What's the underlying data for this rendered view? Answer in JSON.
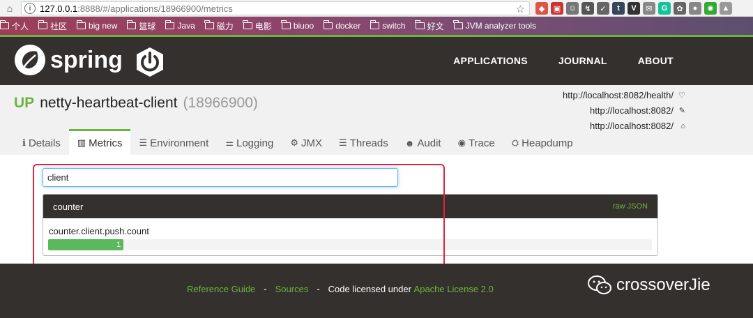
{
  "browser": {
    "url_host": "127.0.0.1",
    "url_rest": ":8888/#/applications/18966900/metrics",
    "bookmarks": [
      "个人",
      "社区",
      "big new",
      "篮球",
      "Java",
      "磁力",
      "电影",
      "biuoo",
      "docker",
      "switch",
      "好文",
      "JVM analyzer tools"
    ],
    "extensions": [
      {
        "name": "ext-multicolor-icon",
        "glyph": "◆",
        "color": "#d54"
      },
      {
        "name": "ext-box-icon",
        "glyph": "▣",
        "color": "#c33"
      },
      {
        "name": "ext-face-icon",
        "glyph": "☺",
        "color": "#777"
      },
      {
        "name": "ext-chart-icon",
        "glyph": "↯",
        "color": "#555"
      },
      {
        "name": "ext-checkbox-icon",
        "glyph": "✓",
        "color": "#666"
      },
      {
        "name": "ext-tumblr-icon",
        "glyph": "t",
        "color": "#35465c"
      },
      {
        "name": "ext-v-icon",
        "glyph": "V",
        "color": "#333"
      },
      {
        "name": "ext-mail-icon",
        "glyph": "✉",
        "color": "#888"
      },
      {
        "name": "ext-grammarly-icon",
        "glyph": "G",
        "color": "#15c39a"
      },
      {
        "name": "ext-puzzle-icon",
        "glyph": "✿",
        "color": "#666"
      },
      {
        "name": "ext-drop-icon",
        "glyph": "●",
        "color": "#888"
      },
      {
        "name": "ext-gear-icon",
        "glyph": "✺",
        "color": "#3a3"
      },
      {
        "name": "ext-arrow-icon",
        "glyph": "▲",
        "color": "#999"
      }
    ]
  },
  "header": {
    "logo_text": "spring",
    "nav": [
      "APPLICATIONS",
      "JOURNAL",
      "ABOUT"
    ]
  },
  "app": {
    "status": "UP",
    "name": "netty-heartbeat-client",
    "id": "(18966900)",
    "health_url": "http://localhost:8082/health/",
    "management_url": "http://localhost:8082/",
    "service_url": "http://localhost:8082/"
  },
  "tabs": [
    {
      "label": "Details",
      "icon": "info-icon",
      "glyph": "ℹ"
    },
    {
      "label": "Metrics",
      "icon": "bar-chart-icon",
      "glyph": "▥"
    },
    {
      "label": "Environment",
      "icon": "list-icon",
      "glyph": "☰"
    },
    {
      "label": "Logging",
      "icon": "sliders-icon",
      "glyph": "⚌"
    },
    {
      "label": "JMX",
      "icon": "cogs-icon",
      "glyph": "⚙"
    },
    {
      "label": "Threads",
      "icon": "threads-icon",
      "glyph": "☰"
    },
    {
      "label": "Audit",
      "icon": "user-icon",
      "glyph": "☻"
    },
    {
      "label": "Trace",
      "icon": "eye-icon",
      "glyph": "◉"
    },
    {
      "label": "Heapdump",
      "icon": "download-icon",
      "glyph": "⛭"
    }
  ],
  "metrics": {
    "search_value": "client",
    "panel_title": "counter",
    "raw_json": "raw JSON",
    "items": [
      {
        "name": "counter.client.push.count",
        "value": "1",
        "fraction": 0.125
      }
    ]
  },
  "footer": {
    "reference_guide": "Reference Guide",
    "sep": "-",
    "sources": "Sources",
    "license_prefix": "Code licensed under",
    "license_link": "Apache License 2.0",
    "watermark": "crossoverJie"
  }
}
